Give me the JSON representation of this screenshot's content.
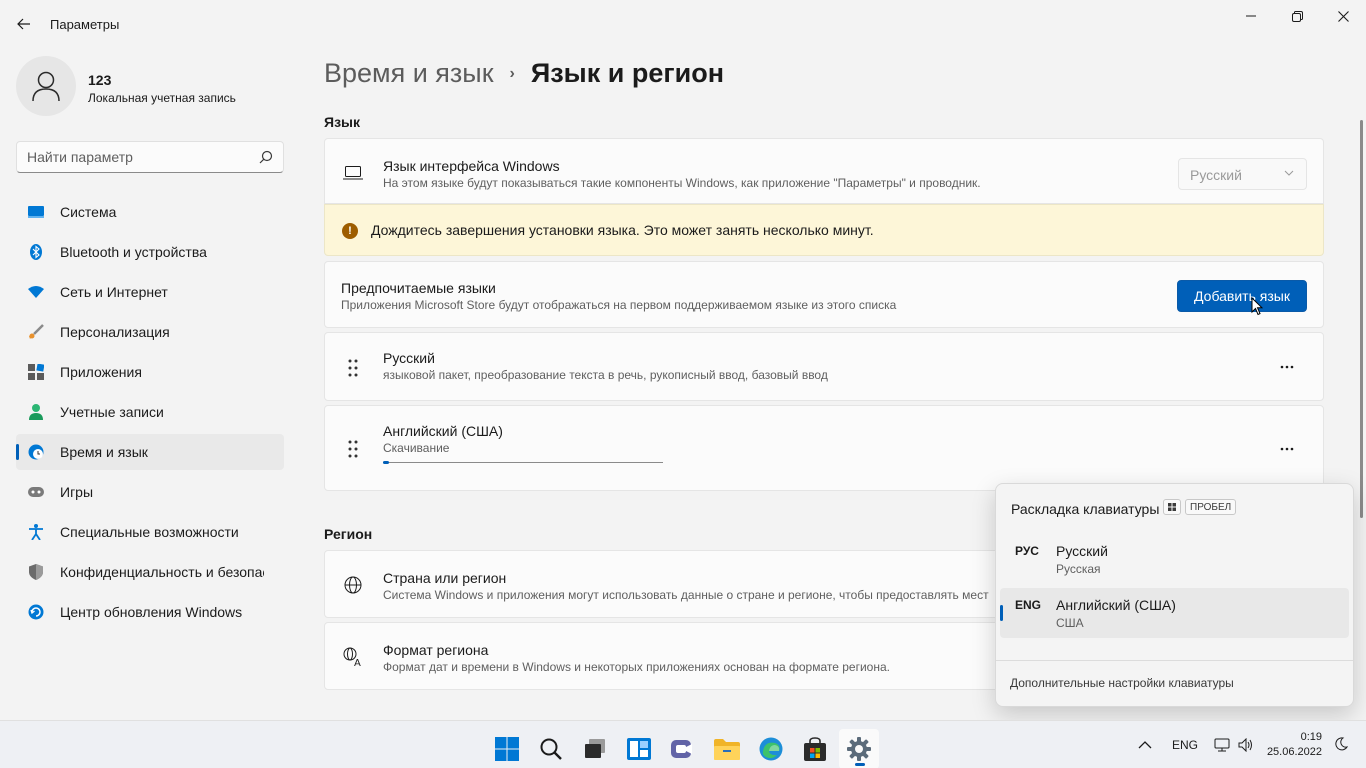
{
  "window": {
    "title": "Параметры",
    "back_icon": "arrow-left-icon",
    "controls": [
      "minimize-icon",
      "restore-icon",
      "close-icon"
    ]
  },
  "profile": {
    "name": "123",
    "account_type": "Локальная учетная запись"
  },
  "search": {
    "placeholder": "Найти параметр"
  },
  "sidebar": {
    "items": [
      {
        "label": "Система",
        "icon": "monitor-icon",
        "color": "#0078d4"
      },
      {
        "label": "Bluetooth и устройства",
        "icon": "bluetooth-icon",
        "color": "#0078d4"
      },
      {
        "label": "Сеть и Интернет",
        "icon": "wifi-icon",
        "color": "#0078d4"
      },
      {
        "label": "Персонализация",
        "icon": "brush-icon",
        "color": "#e8912d"
      },
      {
        "label": "Приложения",
        "icon": "apps-icon",
        "color": "#5b5b5b"
      },
      {
        "label": "Учетные записи",
        "icon": "person-icon",
        "color": "#2bb673"
      },
      {
        "label": "Время и язык",
        "icon": "globe-clock-icon",
        "color": "#0078d4",
        "active": true
      },
      {
        "label": "Игры",
        "icon": "gamepad-icon",
        "color": "#7a7a7a"
      },
      {
        "label": "Специальные возможности",
        "icon": "accessibility-icon",
        "color": "#0078d4"
      },
      {
        "label": "Конфиденциальность и безопасность",
        "icon": "shield-icon",
        "color": "#6b6b6b"
      },
      {
        "label": "Центр обновления Windows",
        "icon": "update-icon",
        "color": "#0078d4"
      }
    ]
  },
  "breadcrumb": {
    "parent": "Время и язык",
    "separator": "›",
    "current": "Язык и регион"
  },
  "language_section": {
    "title": "Язык",
    "display_language": {
      "title": "Язык интерфейса Windows",
      "subtitle": "На этом языке будут показываться такие компоненты Windows, как приложение \"Параметры\" и проводник.",
      "selected": "Русский"
    },
    "warning": "Дождитесь завершения установки языка. Это может занять несколько минут.",
    "preferred": {
      "title": "Предпочитаемые языки",
      "subtitle": "Приложения Microsoft Store будут отображаться на первом поддерживаемом языке из этого списка",
      "add_button": "Добавить язык"
    },
    "languages": [
      {
        "name": "Русский",
        "detail": "языковой пакет, преобразование текста в речь, рукописный ввод, базовый ввод"
      },
      {
        "name": "Английский (США)",
        "detail": "Скачивание",
        "progress": 0.02
      }
    ]
  },
  "region_section": {
    "title": "Регион",
    "country": {
      "title": "Страна или регион",
      "subtitle": "Система Windows и приложения могут использовать данные о стране и регионе, чтобы предоставлять мест"
    },
    "format": {
      "title": "Формат региона",
      "subtitle": "Формат дат и времени в Windows и некоторых приложениях основан на формате региона."
    }
  },
  "keyboard_flyout": {
    "title": "Раскладка клавиатуры",
    "hint_key": "ПРОБЕЛ",
    "items": [
      {
        "code": "РУС",
        "name": "Русский",
        "sub": "Русская"
      },
      {
        "code": "ENG",
        "name": "Английский (США)",
        "sub": "США",
        "selected": true
      }
    ],
    "link": "Дополнительные настройки клавиатуры"
  },
  "taskbar": {
    "apps": [
      "windows-start-icon",
      "search-icon",
      "task-view-icon",
      "widgets-icon",
      "chat-icon",
      "file-explorer-icon",
      "edge-icon",
      "store-icon",
      "settings-icon"
    ],
    "active_app": "settings-icon",
    "language": "ENG",
    "time": "0:19",
    "date": "25.06.2022"
  }
}
